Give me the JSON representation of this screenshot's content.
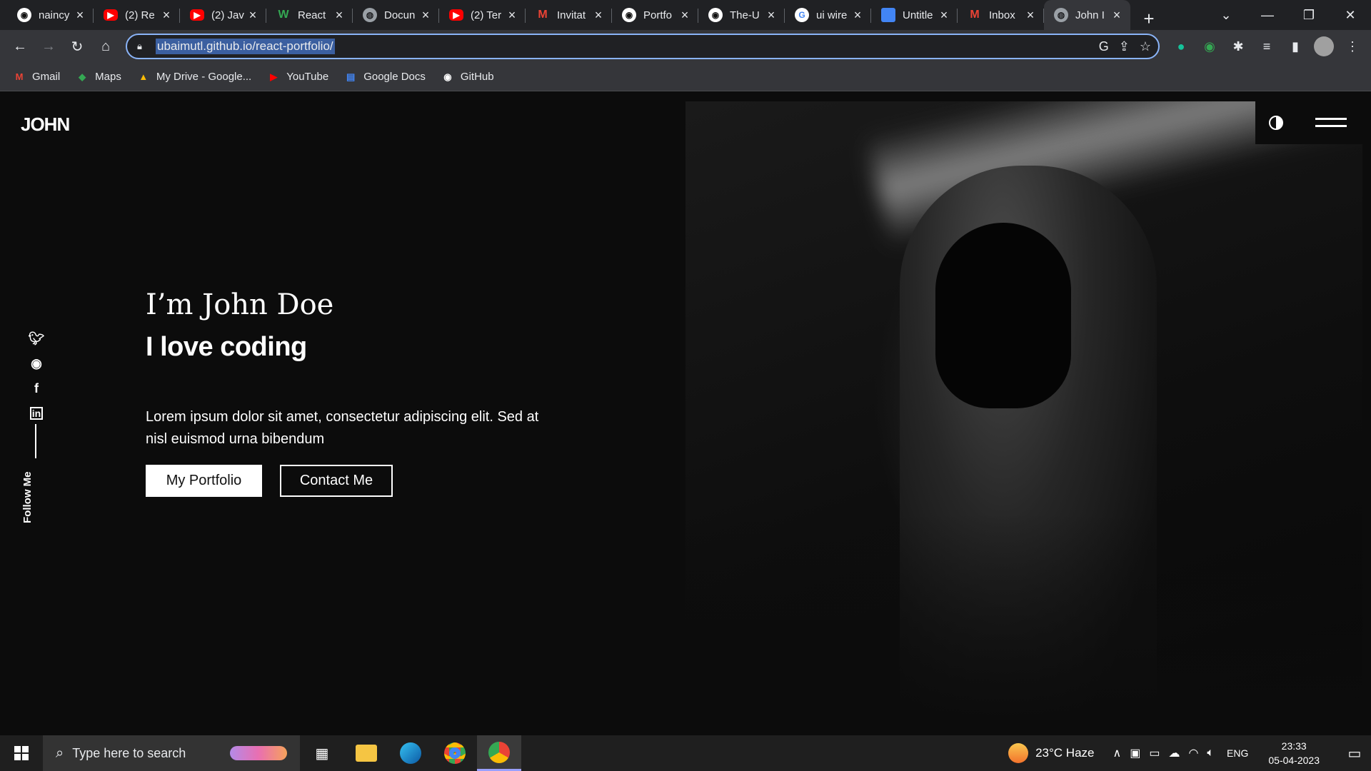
{
  "browser": {
    "tabs": [
      {
        "title": "naincy",
        "icon": "github-icon",
        "kind": "gh"
      },
      {
        "title": "(2) Re",
        "icon": "youtube-icon",
        "kind": "yt"
      },
      {
        "title": "(2) Jav",
        "icon": "youtube-icon",
        "kind": "yt"
      },
      {
        "title": "React",
        "icon": "w-icon",
        "kind": "w"
      },
      {
        "title": "Docun",
        "icon": "globe-icon",
        "kind": "globe"
      },
      {
        "title": "(2) Ter",
        "icon": "youtube-icon",
        "kind": "yt"
      },
      {
        "title": "Invitat",
        "icon": "gmail-icon",
        "kind": "gm"
      },
      {
        "title": "Portfo",
        "icon": "github-icon",
        "kind": "gh"
      },
      {
        "title": "The-U",
        "icon": "github-icon",
        "kind": "gh"
      },
      {
        "title": "ui wire",
        "icon": "google-icon",
        "kind": "g"
      },
      {
        "title": "Untitle",
        "icon": "docs-icon",
        "kind": "doc"
      },
      {
        "title": "Inbox",
        "icon": "gmail-icon",
        "kind": "gm"
      },
      {
        "title": "John I",
        "icon": "globe-icon",
        "kind": "globe",
        "active": true
      }
    ],
    "url": "ubaimutl.github.io/react-portfolio/",
    "bookmarks": [
      {
        "label": "Gmail",
        "icon": "gmail-icon"
      },
      {
        "label": "Maps",
        "icon": "maps-icon"
      },
      {
        "label": "My Drive - Google...",
        "icon": "drive-icon"
      },
      {
        "label": "YouTube",
        "icon": "youtube-icon"
      },
      {
        "label": "Google Docs",
        "icon": "docs-icon"
      },
      {
        "label": "GitHub",
        "icon": "github-icon"
      }
    ]
  },
  "site": {
    "logo": "JOHN",
    "intro": "I’m John Doe",
    "tagline": "I love coding",
    "description": "Lorem ipsum dolor sit amet, consectetur adipiscing elit. Sed at nisl euismod urna bibendum",
    "btn_portfolio": "My Portfolio",
    "btn_contact": "Contact Me",
    "follow_label": "Follow Me",
    "socials": [
      "twitter-icon",
      "github-icon",
      "facebook-icon",
      "linkedin-icon"
    ]
  },
  "taskbar": {
    "search_placeholder": "Type here to search",
    "weather": "23°C  Haze",
    "lang": "ENG",
    "time": "23:33",
    "date": "05-04-2023"
  }
}
